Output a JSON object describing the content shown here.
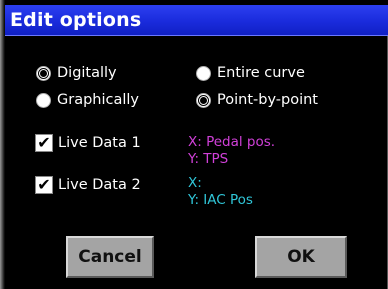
{
  "dialog": {
    "title": "Edit options"
  },
  "edit_mode": {
    "options": [
      {
        "label": "Digitally",
        "selected": true
      },
      {
        "label": "Graphically",
        "selected": false
      }
    ]
  },
  "curve_mode": {
    "options": [
      {
        "label": "Entire curve",
        "selected": false
      },
      {
        "label": "Point-by-point",
        "selected": true
      }
    ]
  },
  "live_data": [
    {
      "label": "Live Data 1",
      "checked": true,
      "x_text": "X: Pedal pos.",
      "y_text": "Y: TPS",
      "color": "#d040d8"
    },
    {
      "label": "Live Data 2",
      "checked": true,
      "x_text": "X:",
      "y_text": "Y: IAC Pos",
      "color": "#30c6d8"
    }
  ],
  "buttons": {
    "cancel_label": "Cancel",
    "ok_label": "OK"
  }
}
